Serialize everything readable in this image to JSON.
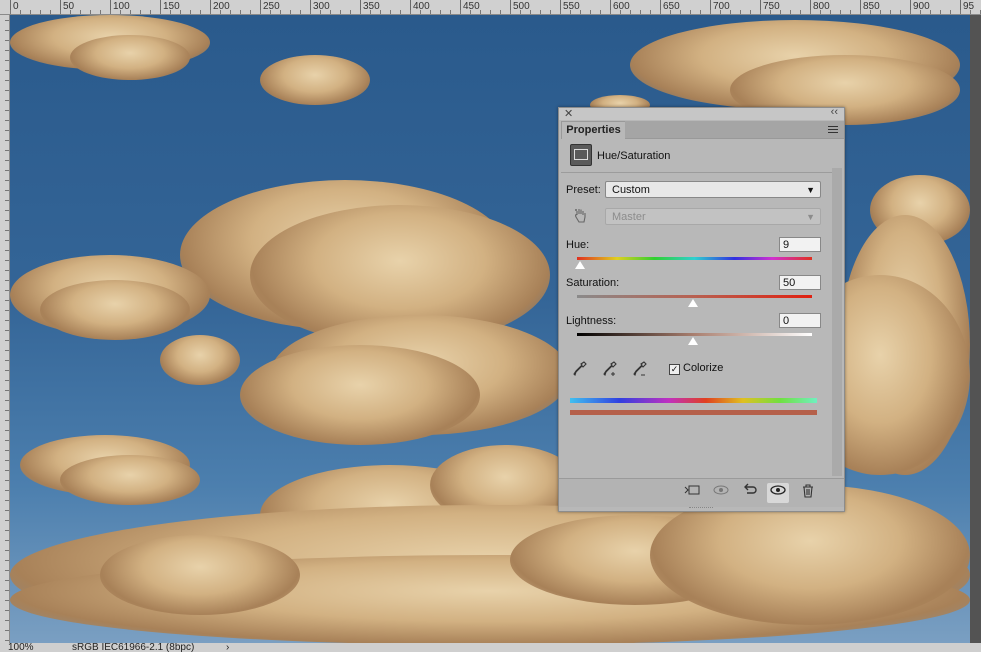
{
  "ruler": {
    "labels": [
      "0",
      "50",
      "100",
      "150",
      "200",
      "250",
      "300",
      "350",
      "400",
      "450",
      "500",
      "550",
      "600",
      "650",
      "700",
      "750",
      "800",
      "850",
      "900",
      "95"
    ]
  },
  "status": {
    "zoom": "100%",
    "profile": "sRGB IEC61966-2.1 (8bpc)",
    "arrow": "›"
  },
  "panel": {
    "close": "✕",
    "collapse": "‹‹",
    "tab": "Properties",
    "layer_title": "Hue/Saturation",
    "preset_label": "Preset:",
    "preset_value": "Custom",
    "range_value": "Master",
    "hue_label": "Hue:",
    "hue_value": "9",
    "saturation_label": "Saturation:",
    "saturation_value": "50",
    "lightness_label": "Lightness:",
    "lightness_value": "0",
    "colorize_label": "Colorize",
    "colorize_checked": true
  },
  "icons": {
    "targeted-adjustment": "hand-icon",
    "eyedropper": "eyedropper-icon",
    "eyedropper-add": "eyedropper-plus-icon",
    "eyedropper-subtract": "eyedropper-minus-icon",
    "clip": "clip-to-layer-icon",
    "view-previous": "view-previous-icon",
    "reset": "reset-icon",
    "visibility": "eye-icon",
    "delete": "trash-icon"
  },
  "colors": {
    "accent_tint": "#b5604a",
    "sky": "#2f6094",
    "cloud": "#c9a77a"
  }
}
